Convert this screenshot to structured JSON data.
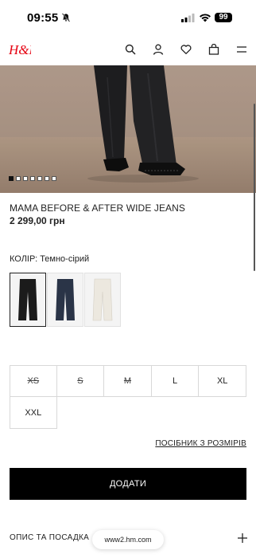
{
  "status_bar": {
    "time": "09:55",
    "battery": "99"
  },
  "header": {
    "logo_text": "H&M",
    "brand_color": "#e50010",
    "icons": [
      "search-icon",
      "account-icon",
      "favorites-icon",
      "bag-icon",
      "menu-icon"
    ]
  },
  "hero": {
    "image": "jeans-on-model-photo",
    "slide_count": 7,
    "active_slide": 1
  },
  "product": {
    "title": "MAMA BEFORE & AFTER WIDE JEANS",
    "price": "2 299,00 грн"
  },
  "color": {
    "label": "КОЛІР: Темно-сірий",
    "swatches": [
      {
        "name": "black",
        "selected": true
      },
      {
        "name": "navy",
        "selected": false
      },
      {
        "name": "cream",
        "selected": false
      }
    ]
  },
  "sizes": [
    {
      "label": "XS",
      "available": false
    },
    {
      "label": "S",
      "available": false
    },
    {
      "label": "M",
      "available": false
    },
    {
      "label": "L",
      "available": true
    },
    {
      "label": "XL",
      "available": true
    },
    {
      "label": "XXL",
      "available": true
    }
  ],
  "size_guide_label": "ПОСІБНИК З РОЗМІРІВ",
  "add_button_label": "ДОДАТИ",
  "description_label": "ОПИС ТА ПОСАДКА",
  "url_pill": "www2.hm.com"
}
